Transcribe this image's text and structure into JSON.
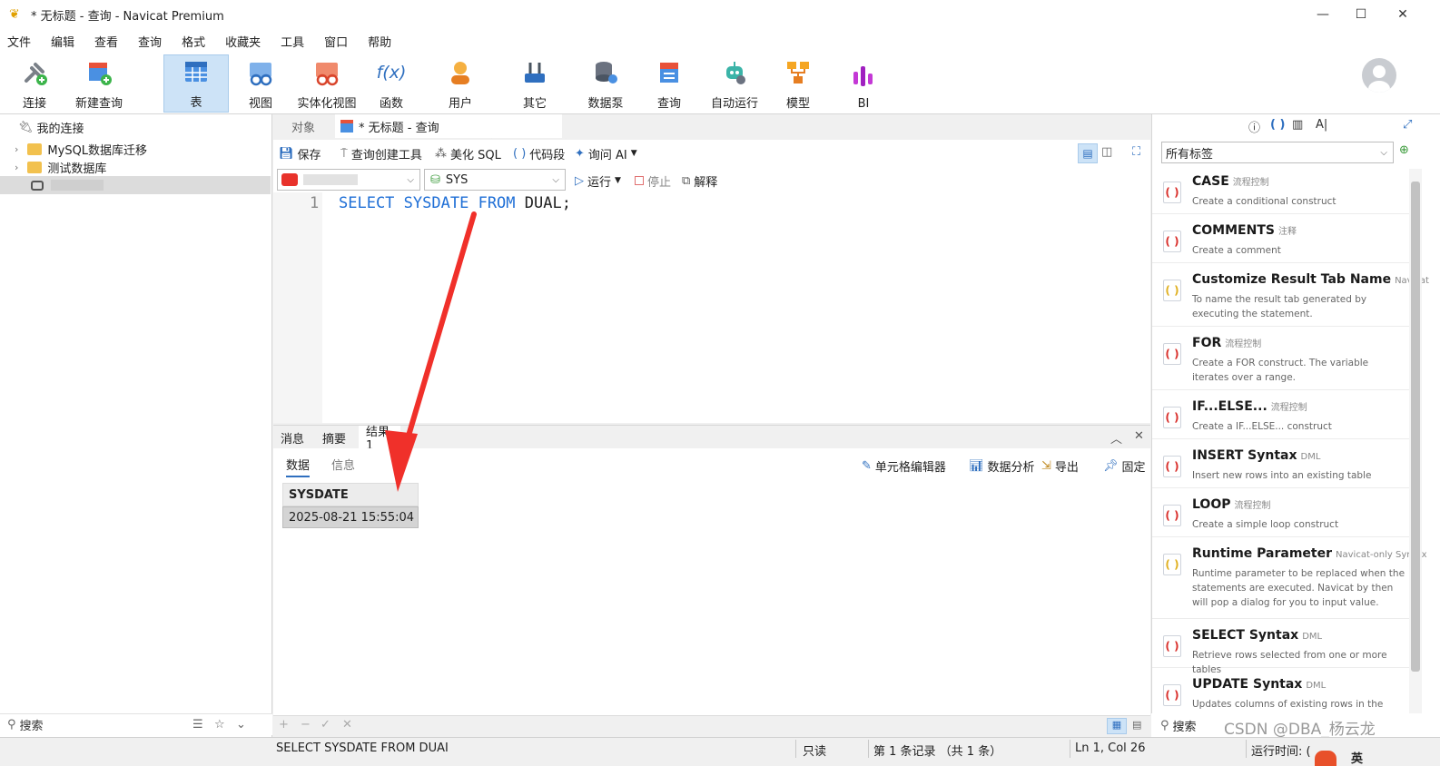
{
  "window": {
    "title": "* 无标题 - 查询 - Navicat Premium",
    "minimize": "—",
    "maximize": "☐",
    "close": "✕"
  },
  "menu": [
    "文件",
    "编辑",
    "查看",
    "查询",
    "格式",
    "收藏夹",
    "工具",
    "窗口",
    "帮助"
  ],
  "toolbar": {
    "connect": "连接",
    "new_query": "新建查询",
    "table": "表",
    "view": "视图",
    "mview": "实体化视图",
    "function": "函数",
    "user": "用户",
    "other": "其它",
    "pump": "数据泵",
    "query": "查询",
    "automation": "自动运行",
    "model": "模型",
    "bi": "BI",
    "fx": "f(x)"
  },
  "navigator": {
    "root": "我的连接",
    "items": [
      "MySQL数据库迁移",
      "测试数据库"
    ],
    "search_placeholder": "搜索"
  },
  "tabs": {
    "objects": "对象",
    "query_tab": "* 无标题 - 查询"
  },
  "query_toolbar": {
    "save": "保存",
    "builder": "查询创建工具",
    "beautify": "美化 SQL",
    "snippet": "代码段",
    "ask_ai": "询问 AI"
  },
  "select_bar": {
    "schema": "SYS",
    "run": "运行",
    "stop": "停止",
    "explain": "解释"
  },
  "editor": {
    "line_number": "1",
    "kw_select": "SELECT",
    "kw_sysdate": "SYSDATE",
    "kw_from": "FROM",
    "rest": "DUAL;"
  },
  "results": {
    "tabs": [
      "消息",
      "摘要",
      "结果 1"
    ],
    "subtabs": [
      "数据",
      "信息"
    ],
    "cell_editor": "单元格编辑器",
    "data_analysis": "数据分析",
    "export": "导出",
    "pin": "固定",
    "column": "SYSDATE",
    "value": "2025-08-21 15:55:04"
  },
  "status": {
    "sql": "SELECT SYSDATE FROM DUAI",
    "readonly": "只读",
    "records": "第 1 条记录 （共 1 条）",
    "position": "Ln 1, Col 26",
    "runtime": "运行时间: (",
    "ime": "英"
  },
  "snippets": {
    "tag_filter": "所有标签",
    "search_placeholder": "搜索",
    "watermark": "CSDN @DBA_杨云龙",
    "items": [
      {
        "title": "CASE",
        "tag": "流程控制",
        "desc": "Create a conditional construct"
      },
      {
        "title": "COMMENTS",
        "tag": "注释",
        "desc": "Create a comment"
      },
      {
        "title": "Customize Result Tab Name",
        "tag": "Navicat",
        "desc": "To name the result tab generated by executing the statement."
      },
      {
        "title": "FOR",
        "tag": "流程控制",
        "desc": "Create a FOR construct. The variable iterates over a range."
      },
      {
        "title": "IF...ELSE...",
        "tag": "流程控制",
        "desc": "Create a IF...ELSE... construct"
      },
      {
        "title": "INSERT Syntax",
        "tag": "DML",
        "desc": "Insert new rows into an existing table"
      },
      {
        "title": "LOOP",
        "tag": "流程控制",
        "desc": "Create a simple loop construct"
      },
      {
        "title": "Runtime Parameter",
        "tag": "Navicat-only Syntax",
        "desc": "Runtime parameter to be replaced when the statements are executed. Navicat by then will pop a dialog for you to input value."
      },
      {
        "title": "SELECT Syntax",
        "tag": "DML",
        "desc": "Retrieve rows selected from one or more tables"
      },
      {
        "title": "UPDATE Syntax",
        "tag": "DML",
        "desc": "Updates columns of existing rows in the named"
      }
    ]
  },
  "colors": {
    "keyword": "#1f6fd6",
    "accent": "#cde3f7",
    "arrow": "#f0302a"
  }
}
